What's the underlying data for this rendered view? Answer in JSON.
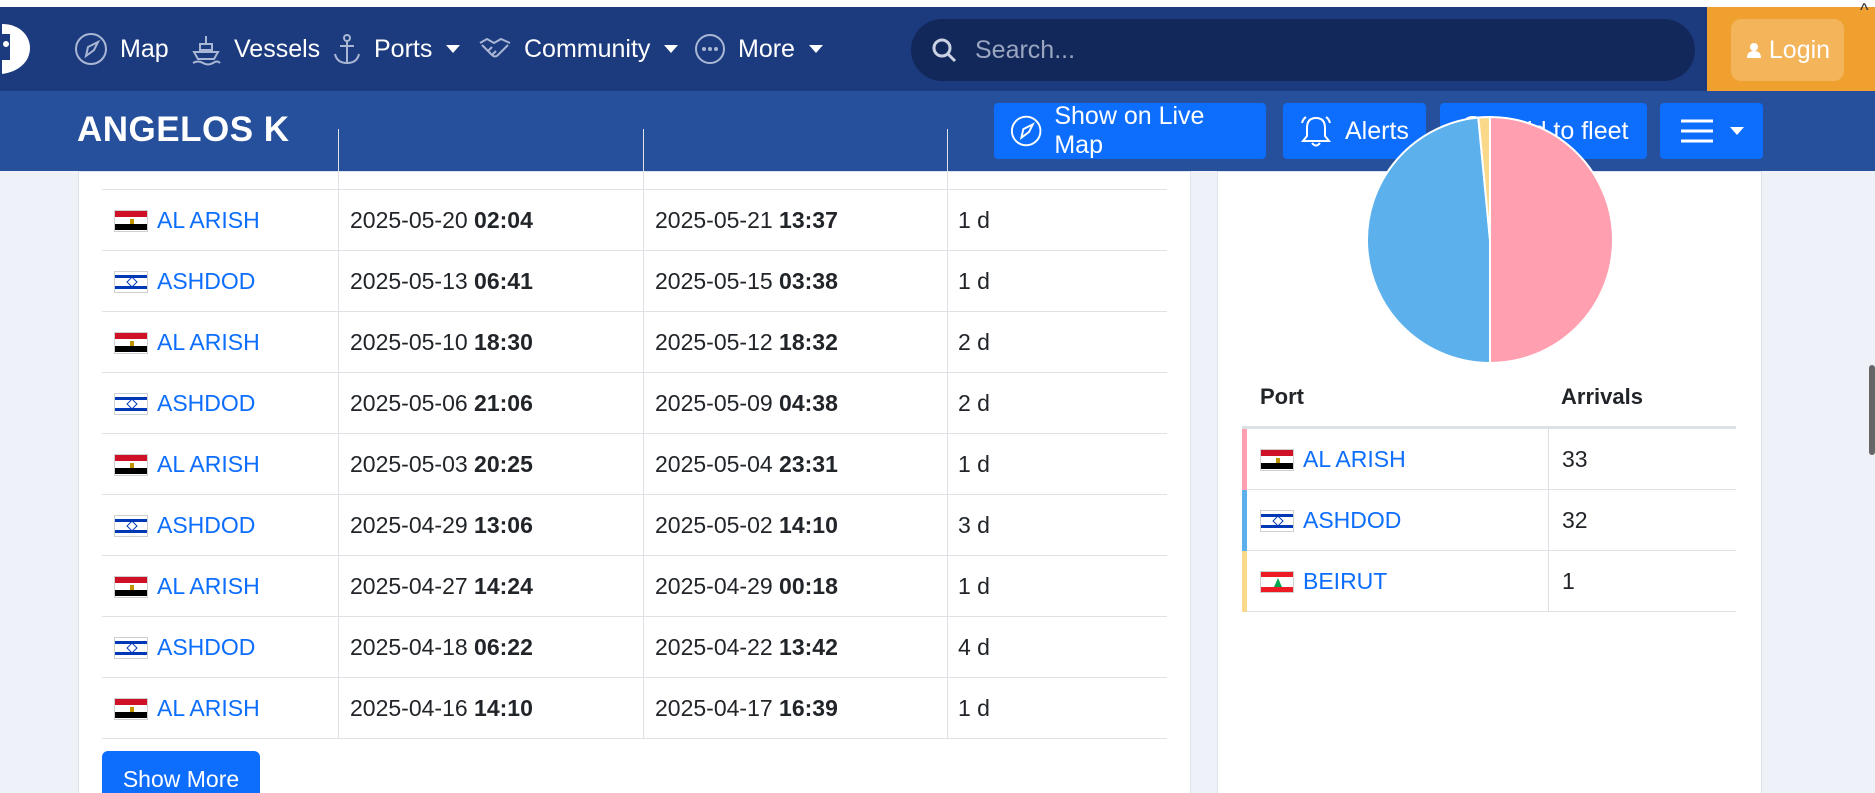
{
  "nav": {
    "items": [
      {
        "label": "Map",
        "icon": "compass-icon"
      },
      {
        "label": "Vessels",
        "icon": "ship-icon"
      },
      {
        "label": "Ports",
        "icon": "anchor-icon",
        "dropdown": true
      },
      {
        "label": "Community",
        "icon": "handshake-icon",
        "dropdown": true
      },
      {
        "label": "More",
        "icon": "more-dots-icon",
        "dropdown": true
      }
    ],
    "search_placeholder": "Search...",
    "login_label": "Login"
  },
  "vessel": {
    "name": "ANGELOS K",
    "actions": {
      "show_on_map": "Show on Live Map",
      "alerts": "Alerts",
      "add_to_fleet": "Add to fleet"
    }
  },
  "port_calls": [
    {
      "flag": "egypt",
      "port": "AL ARISH",
      "arrival_date": "2025-05-20",
      "arrival_time": "02:04",
      "departure_date": "2025-05-21",
      "departure_time": "13:37",
      "duration": "1 d"
    },
    {
      "flag": "israel",
      "port": "ASHDOD",
      "arrival_date": "2025-05-13",
      "arrival_time": "06:41",
      "departure_date": "2025-05-15",
      "departure_time": "03:38",
      "duration": "1 d"
    },
    {
      "flag": "egypt",
      "port": "AL ARISH",
      "arrival_date": "2025-05-10",
      "arrival_time": "18:30",
      "departure_date": "2025-05-12",
      "departure_time": "18:32",
      "duration": "2 d"
    },
    {
      "flag": "israel",
      "port": "ASHDOD",
      "arrival_date": "2025-05-06",
      "arrival_time": "21:06",
      "departure_date": "2025-05-09",
      "departure_time": "04:38",
      "duration": "2 d"
    },
    {
      "flag": "egypt",
      "port": "AL ARISH",
      "arrival_date": "2025-05-03",
      "arrival_time": "20:25",
      "departure_date": "2025-05-04",
      "departure_time": "23:31",
      "duration": "1 d"
    },
    {
      "flag": "israel",
      "port": "ASHDOD",
      "arrival_date": "2025-04-29",
      "arrival_time": "13:06",
      "departure_date": "2025-05-02",
      "departure_time": "14:10",
      "duration": "3 d"
    },
    {
      "flag": "egypt",
      "port": "AL ARISH",
      "arrival_date": "2025-04-27",
      "arrival_time": "14:24",
      "departure_date": "2025-04-29",
      "departure_time": "00:18",
      "duration": "1 d"
    },
    {
      "flag": "israel",
      "port": "ASHDOD",
      "arrival_date": "2025-04-18",
      "arrival_time": "06:22",
      "departure_date": "2025-04-22",
      "departure_time": "13:42",
      "duration": "4 d"
    },
    {
      "flag": "egypt",
      "port": "AL ARISH",
      "arrival_date": "2025-04-16",
      "arrival_time": "14:10",
      "departure_date": "2025-04-17",
      "departure_time": "16:39",
      "duration": "1 d"
    }
  ],
  "show_more_label": "Show More",
  "port_stats": {
    "headers": {
      "port": "Port",
      "arrivals": "Arrivals"
    },
    "rows": [
      {
        "flag": "egypt",
        "port": "AL ARISH",
        "arrivals": "33",
        "color": "#ff9fb0"
      },
      {
        "flag": "israel",
        "port": "ASHDOD",
        "arrivals": "32",
        "color": "#5cb1ec"
      },
      {
        "flag": "lebanon",
        "port": "BEIRUT",
        "arrivals": "1",
        "color": "#fbd98b"
      }
    ]
  },
  "chart_data": {
    "type": "pie",
    "categories": [
      "AL ARISH",
      "ASHDOD",
      "BEIRUT"
    ],
    "values": [
      33,
      32,
      1
    ],
    "colors": [
      "#ff9fb0",
      "#5cb1ec",
      "#fbd98b"
    ]
  },
  "colors": {
    "nav_bg": "#1c3b7e",
    "vessel_bar_bg": "#264f9c",
    "primary": "#0d6efd",
    "login_bg": "#f0a02e"
  }
}
